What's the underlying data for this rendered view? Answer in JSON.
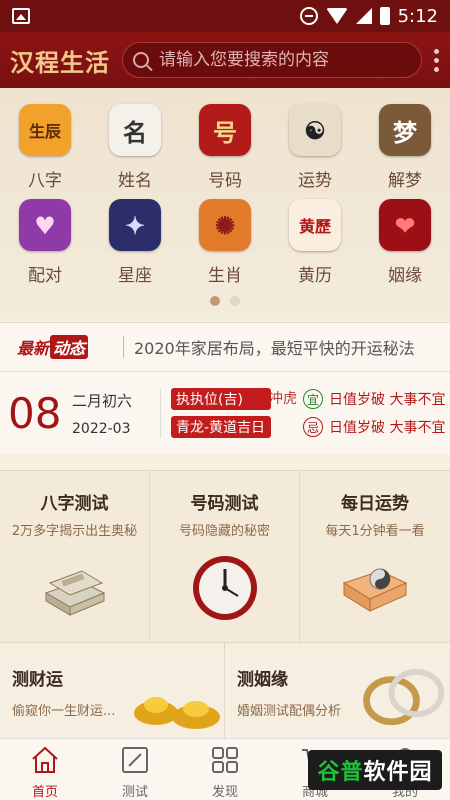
{
  "status_bar": {
    "time": "5:12"
  },
  "header": {
    "logo": "汉程生活",
    "search_placeholder": "请输入您要搜索的内容"
  },
  "grid": [
    {
      "label": "八字",
      "icon": "bazi-icon",
      "glyph": "生辰",
      "bg": "#f2a12a",
      "fg": "#5a2a00"
    },
    {
      "label": "姓名",
      "icon": "name-icon",
      "glyph": "名",
      "bg": "#f4f1ea",
      "fg": "#333333"
    },
    {
      "label": "号码",
      "icon": "number-icon",
      "glyph": "号",
      "bg": "#b31b1b",
      "fg": "#f5d68a"
    },
    {
      "label": "运势",
      "icon": "yinyang-icon",
      "glyph": "☯",
      "bg": "#e8ddc9",
      "fg": "#222222"
    },
    {
      "label": "解梦",
      "icon": "dream-icon",
      "glyph": "梦",
      "bg": "#7b5a3a",
      "fg": "#ffffff"
    },
    {
      "label": "配对",
      "icon": "match-icon",
      "glyph": "♥",
      "bg": "#8e3aa8",
      "fg": "#ffd6f0"
    },
    {
      "label": "星座",
      "icon": "constellation-icon",
      "glyph": "✦",
      "bg": "#2b2e6a",
      "fg": "#d9d9ff"
    },
    {
      "label": "生肖",
      "icon": "zodiac-icon",
      "glyph": "✺",
      "bg": "#e27a2a",
      "fg": "#8a1c1c"
    },
    {
      "label": "黄历",
      "icon": "almanac-icon",
      "glyph": "黄歷",
      "bg": "#fbeee0",
      "fg": "#b01818"
    },
    {
      "label": "姻缘",
      "icon": "heart-icon",
      "glyph": "❤",
      "bg": "#9c0f15",
      "fg": "#ff7a7a"
    }
  ],
  "news": {
    "tag_a": "最新",
    "tag_b": "动态",
    "text": "2020年家居布局，最短平快的开运秘法"
  },
  "almanac": {
    "day": "08",
    "lunar": "二月初六",
    "year_month": "2022-03",
    "tag1": "执执位(吉)",
    "tag2": "青龙-黄道吉日",
    "side": "冲虎",
    "yi_label": "宜",
    "ji_label": "忌",
    "yi_text": "日值岁破 大事不宜",
    "ji_text": "日值岁破 大事不宜"
  },
  "tests": [
    {
      "title": "八字测试",
      "sub": "2万多字揭示出生奥秘",
      "icon": "books-icon"
    },
    {
      "title": "号码测试",
      "sub": "号码隐藏的秘密",
      "icon": "clock-icon"
    },
    {
      "title": "每日运势",
      "sub": "每天1分钟看一看",
      "icon": "fortune-book-icon"
    }
  ],
  "bottom": [
    {
      "title": "测财运",
      "sub": "偷窥你一生财运...",
      "icon": "gold-ingot-icon"
    },
    {
      "title": "测姻缘",
      "sub": "婚姻测试配偶分析",
      "icon": "rings-icon"
    }
  ],
  "tabs": [
    {
      "label": "首页",
      "icon": "home-icon"
    },
    {
      "label": "测试",
      "icon": "edit-icon"
    },
    {
      "label": "发现",
      "icon": "grid-icon"
    },
    {
      "label": "商城",
      "icon": "cart-icon"
    },
    {
      "label": "我的",
      "icon": "user-icon"
    }
  ],
  "watermark": {
    "part1": "谷普",
    "part2": "软件园"
  }
}
